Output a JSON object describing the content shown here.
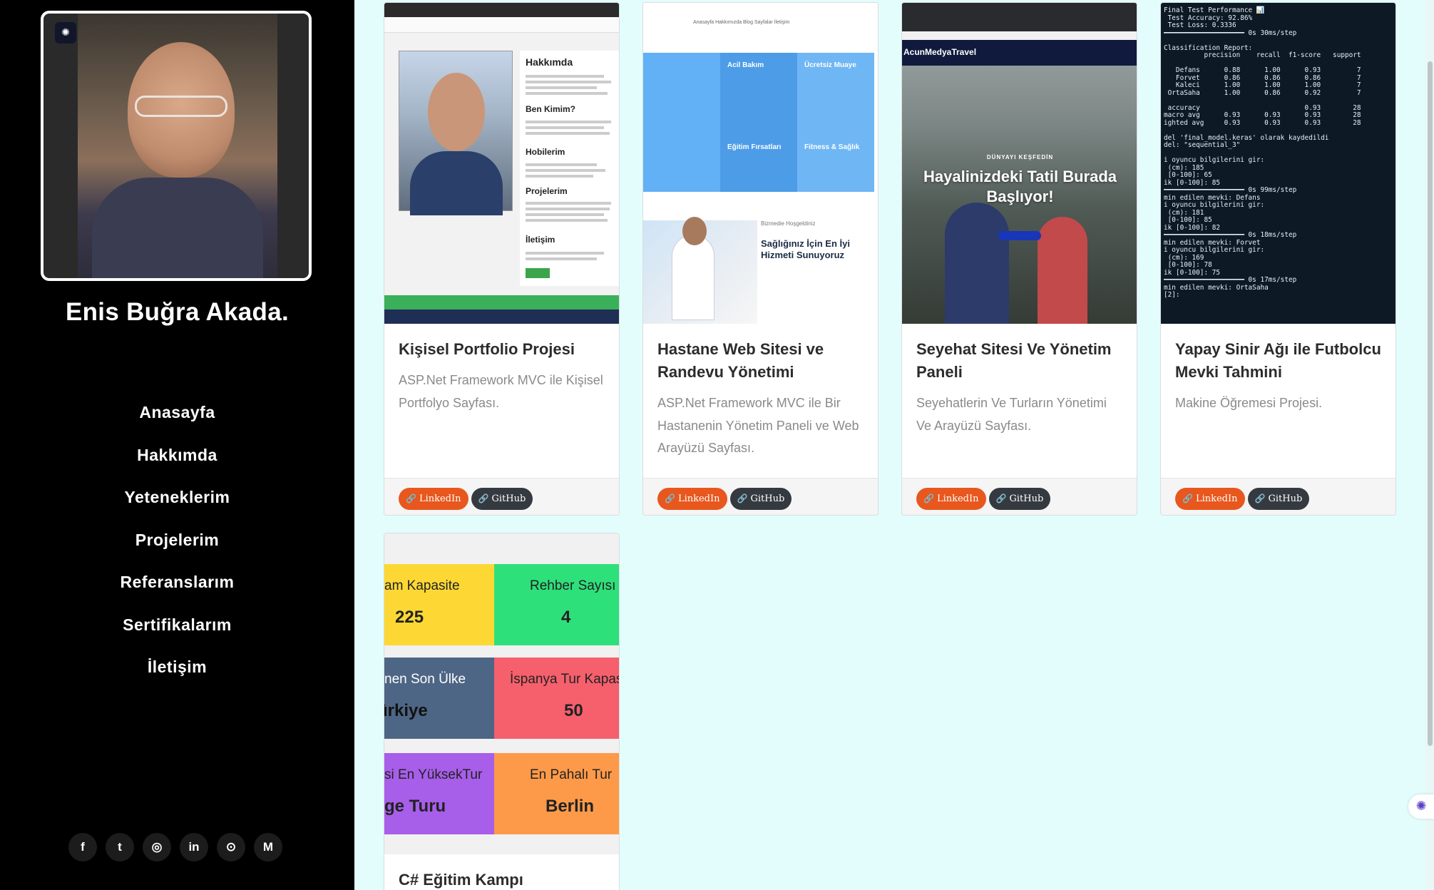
{
  "sidebar": {
    "name": "Enis Buğra Akada.",
    "nav": [
      "Anasayfa",
      "Hakkımda",
      "Yeteneklerim",
      "Projelerim",
      "Referanslarım",
      "Sertifikalarım",
      "İletişim"
    ],
    "socials": [
      {
        "icon": "facebook-icon",
        "glyph": "f"
      },
      {
        "icon": "twitter-icon",
        "glyph": "t"
      },
      {
        "icon": "instagram-icon",
        "glyph": "◎"
      },
      {
        "icon": "linkedin-icon",
        "glyph": "in"
      },
      {
        "icon": "github-icon",
        "glyph": "⊙"
      },
      {
        "icon": "medium-icon",
        "glyph": "M"
      }
    ]
  },
  "projects": [
    {
      "title": "Kişisel Portfolio Projesi",
      "desc": "ASP.Net Framework MVC ile Kişisel Portfolyo Sayfası.",
      "linkedin": "LinkedIn",
      "github": "GitHub",
      "thumb": {
        "headings": [
          "Hakkımda",
          "Ben Kimim?",
          "Hobilerim",
          "Projelerim",
          "İletişim"
        ]
      }
    },
    {
      "title": "Hastane Web Sitesi ve Randevu Yönetimi",
      "desc": "ASP.Net Framework MVC ile Bir Hastanenin Yönetim Paneli ve Web Arayüzü Sayfası.",
      "linkedin": "LinkedIn",
      "github": "GitHub",
      "thumb": {
        "nav": "Anasayfa  Hakkımızda  Blog  Sayfalar  İletişim",
        "cols": [
          "Acil Bakım",
          "Ücretsiz Muaye",
          "Eğitim Fırsatları",
          "Fitness & Sağlık"
        ],
        "kicker": "Bizmedie Hoşgeldiniz",
        "headline": "Sağlığınız İçin En İyi Hizmeti Sunuyoruz"
      }
    },
    {
      "title": "Seyehat Sitesi Ve Yönetim Paneli",
      "desc": "Seyehatlerin Ve Turların Yönetimi Ve Arayüzü Sayfası.",
      "linkedin": "LinkedIn",
      "github": "GitHub",
      "thumb": {
        "brand": "AcunMedyaTravel",
        "eyebrow": "DÜNYAYI KEŞFEDİN",
        "headline": "Hayalinizdeki Tatil Burada Başlıyor!"
      }
    },
    {
      "title": "Yapay Sinir Ağı ile Futbolcu Mevki Tahmini",
      "desc": "Makine Öğremesi Projesi.",
      "linkedin": "LinkedIn",
      "github": "GitHub",
      "thumb": {
        "terminal": "Final Test Performance 📊\n Test Accuracy: 92.86%\n Test Loss: 0.3336\n━━━━━━━━━━━━━━━━━━━━ 0s 30ms/step\n\nClassification Report:\n          precision    recall  f1-score   support\n\n   Defans      0.88      1.00      0.93         7\n   Forvet      0.86      0.86      0.86         7\n   Kaleci      1.00      1.00      1.00         7\n OrtaSaha      1.00      0.86      0.92         7\n\n accuracy                          0.93        28\nmacro avg      0.93      0.93      0.93        28\nighted avg     0.93      0.93      0.93        28\n\ndel 'final_model.keras' olarak kaydedildi\ndel: \"sequential_3\"\n\ni oyuncu bilgilerini gir:\n (cm): 185\n [0-100]: 65\nik [0-100]: 85\n━━━━━━━━━━━━━━━━━━━━ 0s 99ms/step\nmin edilen mevki: Defans\ni oyuncu bilgilerini gir:\n (cm): 181\n [0-100]: 85\nik [0-100]: 82\n━━━━━━━━━━━━━━━━━━━━ 0s 18ms/step\nmin edilen mevki: Forvet\ni oyuncu bilgilerini gir:\n (cm): 169\n [0-100]: 78\nik [0-100]: 75\n━━━━━━━━━━━━━━━━━━━━ 0s 17ms/step\nmin edilen mevki: OrtaSaha\n[2]:"
      }
    }
  ],
  "project5": {
    "title": "C# Eğitim Kampı",
    "tiles": [
      {
        "label": "am Kapasite",
        "value": "225",
        "color": "#fdd835"
      },
      {
        "label": "Rehber Sayısı",
        "value": "4",
        "color": "#2ee07a"
      },
      {
        "label": "nen Son Ülke",
        "value": "ürkiye",
        "color": "#4e6685"
      },
      {
        "label": "İspanya Tur Kapas",
        "value": "50",
        "color": "#f5606c"
      },
      {
        "label": "si En YüksekTur",
        "value": "ge Turu",
        "color": "#a75ee9"
      },
      {
        "label": "En Pahalı Tur",
        "value": "Berlin",
        "color": "#fd9a4a"
      }
    ]
  }
}
